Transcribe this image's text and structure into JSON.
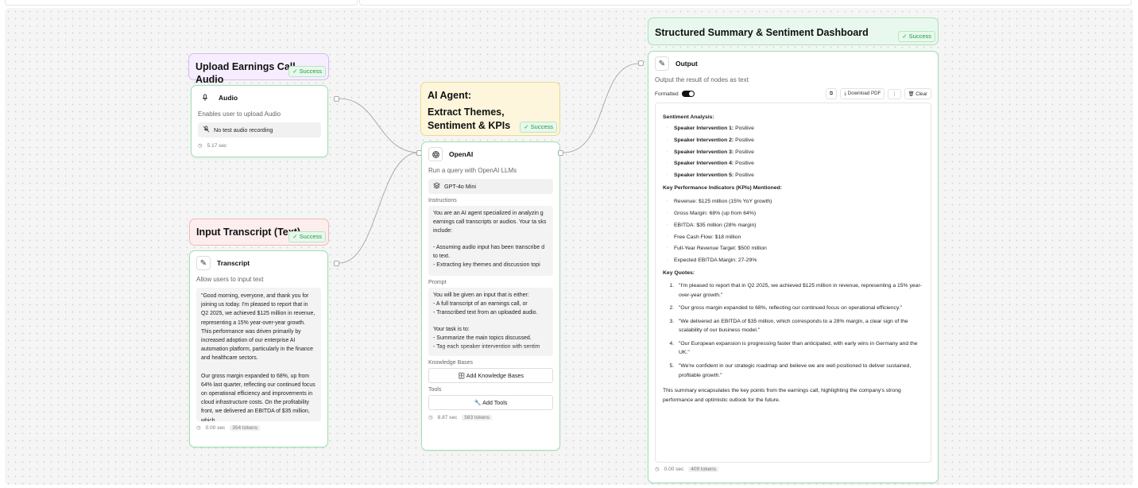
{
  "nodes": {
    "audio": {
      "header": "Upload Earnings Call Audio",
      "status": "✓ Success",
      "title": "Audio",
      "description": "Enables user to upload Audio",
      "recording": "No test audio recording",
      "time": "5.17 sec"
    },
    "transcript": {
      "header": "Input Transcript (Text)",
      "status": "✓ Success",
      "title": "Transcript",
      "description": "Allow users to input text",
      "text": "\"Good morning, everyone, and thank you for joining us today. I'm pleased to report that in Q2 2025, we achieved $125 million in revenue, representing a 15% year-over-year growth. This performance was driven primarily by increased adoption of our enterprise AI automation platform, particularly in the finance and healthcare sectors.\n\nOur gross margin expanded to 68%, up from 64% last quarter, reflecting our continued focus on operational efficiency and improvements in cloud infrastructure costs. On the profitability front, we delivered an EBITDA of $35 million, which",
      "time": "0.00 sec",
      "tokens": "354 tokens"
    },
    "agent": {
      "header_line1": "AI Agent:",
      "header_line2": "Extract Themes, Sentiment & KPIs",
      "status": "✓ Success",
      "title": "OpenAI",
      "description": "Run a query with OpenAI LLMs",
      "model": "GPT-4o Mini",
      "instructions_label": "Instructions",
      "instructions": "You are an AI agent specialized in analyzin g earnings call transcripts or audios. Your ta sks include:\n\n- Assuming audio input has been transcribe d to text.\n- Extracting key themes and discussion topi",
      "prompt_label": "Prompt",
      "prompt": "You will be given an input that is either:\n- A full transcript of an earnings call, or\n- Transcribed text from an uploaded audio.\n\nYour task is to:\n- Summarize the main topics discussed.\n- Tag each speaker intervention with sentim",
      "kb_label": "Knowledge Bases",
      "kb_button": "Add Knowledge Bases",
      "tools_label": "Tools",
      "tools_button": "Add Tools",
      "time": "8.87 sec",
      "tokens": "583 tokens"
    },
    "output": {
      "header": "Structured Summary & Sentiment Dashboard",
      "status": "✓ Success",
      "title": "Output",
      "description": "Output the result of nodes as text",
      "formatted_label": "Formatted",
      "download_label": "Download PDF",
      "clear_label": "Clear",
      "sentiment_heading": "Sentiment Analysis:",
      "sentiments": [
        {
          "speaker": "Speaker Intervention 1:",
          "value": "Positive"
        },
        {
          "speaker": "Speaker Intervention 2:",
          "value": "Positive"
        },
        {
          "speaker": "Speaker Intervention 3:",
          "value": "Positive"
        },
        {
          "speaker": "Speaker Intervention 4:",
          "value": "Positive"
        },
        {
          "speaker": "Speaker Intervention 5:",
          "value": "Positive"
        }
      ],
      "kpi_heading": "Key Performance Indicators (KPIs) Mentioned:",
      "kpis": [
        "Revenue: $125 million (15% YoY growth)",
        "Gross Margin: 68% (up from 64%)",
        "EBITDA: $35 million (28% margin)",
        "Free Cash Flow: $18 million",
        "Full-Year Revenue Target: $500 million",
        "Expected EBITDA Margin: 27-29%"
      ],
      "quotes_heading": "Key Quotes:",
      "quotes": [
        "\"I'm pleased to report that in Q2 2025, we achieved $125 million in revenue, representing a 15% year-over-year growth.\"",
        "\"Our gross margin expanded to 68%, reflecting our continued focus on operational efficiency.\"",
        "\"We delivered an EBITDA of $35 million, which corresponds to a 28% margin, a clear sign of the scalability of our business model.\"",
        "\"Our European expansion is progressing faster than anticipated, with early wins in Germany and the UK.\"",
        "\"We're confident in our strategic roadmap and believe we are well positioned to deliver sustained, profitable growth.\""
      ],
      "closing": "This summary encapsulates the key points from the earnings call, highlighting the company's strong performance and optimistic outlook for the future.",
      "time": "0.00 sec",
      "tokens": "409 tokens"
    }
  },
  "colors": {
    "audio_header_bg": "#f6eefe",
    "audio_header_border": "#d8b8f2",
    "transcript_header_bg": "#fdeeee",
    "transcript_header_border": "#f2b8b8",
    "agent_header_bg": "#fdf6dc",
    "agent_header_border": "#ecd98e",
    "output_header_bg": "#e9f8ee",
    "output_header_border": "#a8e2b8",
    "success": "#1f9a45"
  },
  "icons": {
    "audio": "microphone-icon",
    "mute": "microphone-off-icon",
    "transcript": "pencil-icon",
    "openai": "openai-logo-icon",
    "model": "cube-stack-icon",
    "kb": "database-icon",
    "tools": "wrench-icon",
    "output": "pencil-icon",
    "copy": "copy-icon",
    "download": "download-icon",
    "more": "more-vertical-icon",
    "trash": "trash-icon",
    "clock": "clock-icon"
  }
}
